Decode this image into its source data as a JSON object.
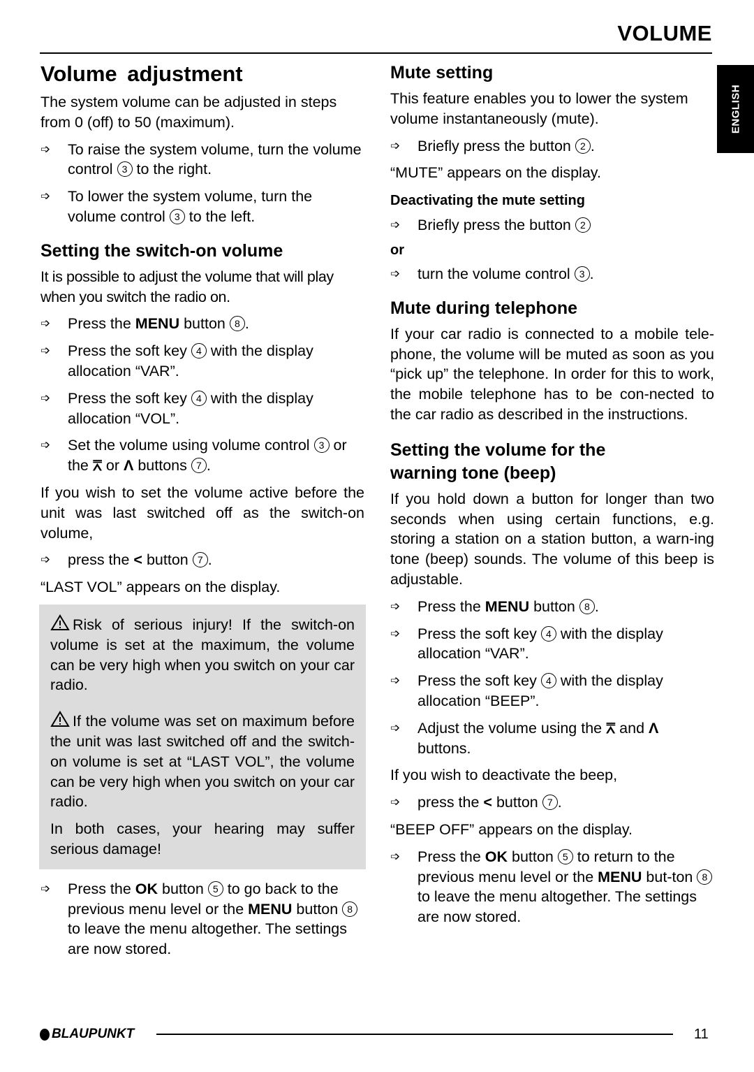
{
  "header": {
    "section_title": "VOLUME",
    "language_tab": "ENGLISH"
  },
  "left": {
    "title": "Volume adjustment",
    "intro": "The system volume can be adjusted in steps from 0 (off) to 50 (maximum).",
    "raise": {
      "pre": "To raise the system volume, turn the volume control ",
      "num": "3",
      "post": " to the right."
    },
    "lower": {
      "pre": "To lower the system volume, turn the volume control ",
      "num": "3",
      "post": " to the left."
    },
    "switch_on": {
      "title": "Setting the switch-on volume",
      "intro": "It is possible to adjust the volume that will play when you switch the radio on.",
      "step1": {
        "pre": "Press the ",
        "bold": "MENU",
        "mid": " button ",
        "num": "8",
        "post": "."
      },
      "step2": {
        "pre": "Press the soft key ",
        "num": "4",
        "post": " with the display allocation “VAR”."
      },
      "step3": {
        "pre": "Press the soft key ",
        "num": "4",
        "post": " with the display allocation “VOL”."
      },
      "step4": {
        "pre": "Set the volume using volume control ",
        "num": "3",
        "mid": " or the ",
        "down": "⩞",
        "or": " or ",
        "up": "Λ",
        "mid2": " buttons ",
        "num2": "7",
        "post": "."
      },
      "last_vol_intro": "If you wish to set the volume active before the unit was last switched off as the switch-on volume,",
      "step5": {
        "pre": "press the ",
        "sym": "<",
        "mid": " button ",
        "num": "7",
        "post": "."
      },
      "last_vol_display": "“LAST VOL” appears on the display."
    },
    "warning": {
      "p1": "Risk of serious injury! If the switch-on volume is set at the maximum, the volume can be very high when you switch on your car radio.",
      "p2": "If the volume was set on maximum before the unit was last switched off and the switch-on volume is set at “LAST VOL”, the volume can be very high when you switch on your car radio.",
      "p3": "In both cases, your hearing may suffer serious damage!"
    },
    "final_step": {
      "pre": "Press the ",
      "ok": "OK",
      "mid1": " button ",
      "num1": "5",
      "mid2": " to go back to the previous menu level or the ",
      "menu": "MENU",
      "mid3": " button ",
      "num2": "8",
      "post": " to leave the menu altogether. The settings are now stored."
    }
  },
  "right": {
    "mute": {
      "title": "Mute setting",
      "intro": "This feature enables you to lower the system volume instantaneously (mute).",
      "step1": {
        "pre": "Briefly press the button ",
        "num": "2",
        "post": "."
      },
      "display": "“MUTE” appears on the display.",
      "deactivate_title": "Deactivating the mute setting",
      "step2": {
        "pre": "Briefly press the button ",
        "num": "2",
        "post": ""
      },
      "or": "or",
      "step3": {
        "pre": "turn the volume control ",
        "num": "3",
        "post": "."
      }
    },
    "telephone": {
      "title": "Mute during telephone",
      "body": "If your car radio is connected to a mobile tele-phone, the volume will be muted as soon as you “pick up” the telephone. In order for this to work, the mobile telephone has to be con-nected to the car radio as described in the instructions."
    },
    "beep": {
      "title": "Setting the volume for the warning tone (beep)",
      "body": "If you hold down a button for longer than two seconds when using certain functions, e.g. storing a station on a station button, a warn-ing tone (beep) sounds. The volume of this beep is adjustable.",
      "step1": {
        "pre": "Press the ",
        "bold": "MENU",
        "mid": " button ",
        "num": "8",
        "post": "."
      },
      "step2": {
        "pre": "Press the soft key ",
        "num": "4",
        "post": " with the display allocation “VAR”."
      },
      "step3": {
        "pre": "Press the soft key ",
        "num": "4",
        "post": " with the display allocation “BEEP”."
      },
      "step4": {
        "pre": "Adjust the volume using the ",
        "down": "⩞",
        "and": " and ",
        "up": "Λ",
        "post": " buttons."
      },
      "deactivate_intro": "If you wish to deactivate the beep,",
      "step5": {
        "pre": "press the ",
        "sym": "<",
        "mid": " button ",
        "num": "7",
        "post": "."
      },
      "display": "“BEEP OFF” appears on the display.",
      "final_step": {
        "pre": "Press the ",
        "ok": "OK",
        "mid1": " button ",
        "num1": "5",
        "mid2": " to return to the previous menu level or the ",
        "menu": "MENU",
        "mid3": " but-ton ",
        "num2": "8",
        "post": " to leave the menu altogether. The settings are now stored."
      }
    }
  },
  "footer": {
    "brand": "BLAUPUNKT",
    "page_number": "11"
  },
  "icons": {
    "step_arrow": "➩"
  }
}
